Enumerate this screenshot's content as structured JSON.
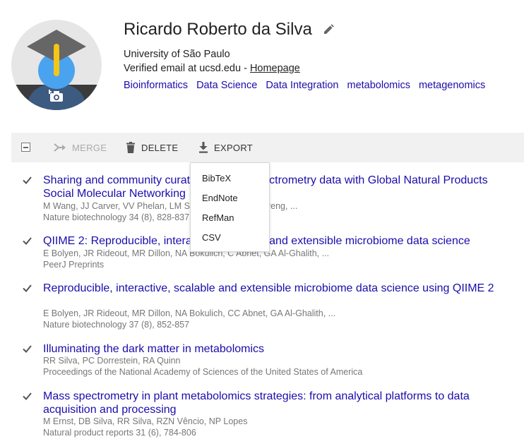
{
  "profile": {
    "name": "Ricardo Roberto da Silva",
    "affiliation": "University of São Paulo",
    "email_text": "Verified email at ucsd.edu - ",
    "homepage_label": "Homepage",
    "interests": [
      "Bioinformatics",
      "Data Science",
      "Data Integration",
      "metabolomics",
      "metagenomics"
    ]
  },
  "toolbar": {
    "merge_label": "MERGE",
    "delete_label": "DELETE",
    "export_label": "EXPORT"
  },
  "export_menu": {
    "items": [
      "BibTeX",
      "EndNote",
      "RefMan",
      "CSV"
    ]
  },
  "articles": [
    {
      "title": "Sharing and community curation of mass spectrometry data with Global Natural Products Social Molecular Networking",
      "authors": "M Wang, JJ Carver, VV Phelan, LM Sanchez, N Garg, Y Peng, ...",
      "venue": "Nature biotechnology 34 (8), 828-837",
      "checked": true
    },
    {
      "title": "QIIME 2: Reproducible, interactive, scalable, and extensible microbiome data science",
      "authors": "E Bolyen, JR Rideout, MR Dillon, NA Bokulich, C Abnet, GA Al-Ghalith, ...",
      "venue": "PeerJ Preprints",
      "checked": true
    },
    {
      "title": "Reproducible, interactive, scalable and extensible microbiome data science using QIIME 2",
      "authors": "E Bolyen, JR Rideout, MR Dillon, NA Bokulich, CC Abnet, GA Al-Ghalith, ...",
      "venue": "Nature biotechnology 37 (8), 852-857",
      "checked": true
    },
    {
      "title": "Illuminating the dark matter in metabolomics",
      "authors": "RR Silva, PC Dorrestein, RA Quinn",
      "venue": "Proceedings of the National Academy of Sciences of the United States of America",
      "checked": true
    },
    {
      "title": "Mass spectrometry in plant metabolomics strategies: from analytical platforms to data acquisition and processing",
      "authors": "M Ernst, DB Silva, RR Silva, RZN Vêncio, NP Lopes",
      "venue": "Natural product reports 31 (6), 784-806",
      "checked": true
    }
  ],
  "colors": {
    "link": "#1a0dab",
    "meta": "#777777",
    "toolbar_bg": "#f1f1f1",
    "avatar_bg": "#e6e6e6",
    "avatar_body": "#3d5a80",
    "avatar_face": "#4aa3ef",
    "cap": "#666666",
    "tassel": "#f5c518"
  }
}
